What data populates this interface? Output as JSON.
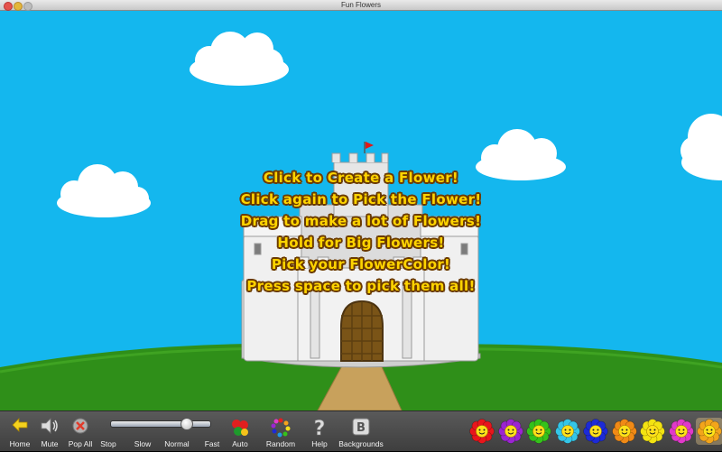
{
  "window": {
    "title": "Fun Flowers"
  },
  "instructions": [
    "Click to Create a Flower!",
    "Click again to Pick the Flower!",
    "Drag to make a lot of Flowers!",
    "Hold for Big Flowers!",
    "Pick your FlowerColor!",
    "Press space to pick them all!"
  ],
  "toolbar": {
    "home_label": "Home",
    "mute_label": "Mute",
    "popall_label": "Pop All",
    "stop_label": "Stop",
    "slow_label": "Slow",
    "normal_label": "Normal",
    "fast_label": "Fast",
    "auto_label": "Auto",
    "random_label": "Random",
    "help_label": "Help",
    "backgrounds_label": "Backgrounds",
    "speed_value": 0.75
  },
  "flower_colors": [
    "#e8161c",
    "#9b25d1",
    "#35c21b",
    "#34c6e8",
    "#1d2bd6",
    "#f08a16",
    "#f3e312",
    "#e03ac9",
    "#f3a51b"
  ],
  "selected_flower": 8,
  "colors": {
    "sky": "#14b7ee",
    "grass": "#2f8f19",
    "text": "#ffd400"
  }
}
